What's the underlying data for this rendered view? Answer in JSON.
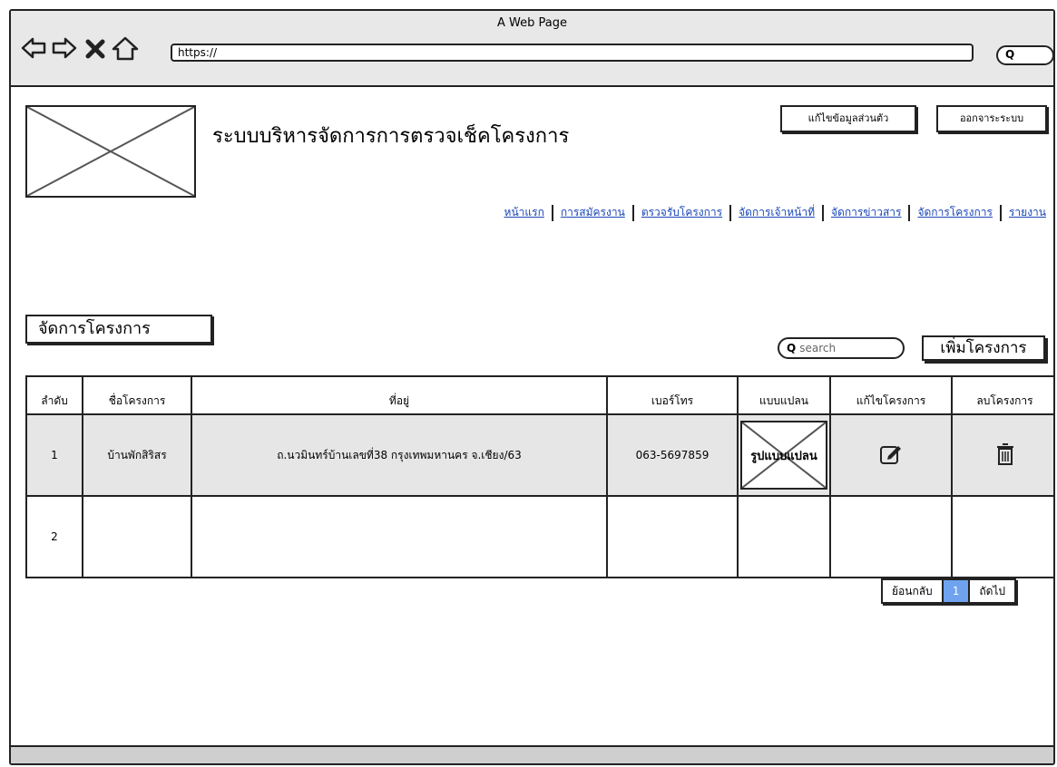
{
  "browser": {
    "window_title": "A Web Page",
    "url": "https://",
    "search_icon_label": "Q"
  },
  "header": {
    "app_title": "ระบบบริหารจัดการการตรวจเช็คโครงการ",
    "edit_profile_label": "แก้ไขข้อมูลส่วนตัว",
    "logout_label": "ออกจาระระบบ"
  },
  "menu": {
    "items": [
      {
        "label": "หน้าแรก"
      },
      {
        "label": "การสมัครงาน"
      },
      {
        "label": "ตรวจรับโครงการ"
      },
      {
        "label": "จัดการเจ้าหน้าที่"
      },
      {
        "label": "จัดการข่าวสาร"
      },
      {
        "label": "จัดการโครงการ"
      },
      {
        "label": "รายงาน"
      }
    ]
  },
  "content": {
    "section_title": "จัดการโครงการ",
    "search_placeholder": "search",
    "add_button_label": "เพิ่มโครงการ"
  },
  "table": {
    "headers": [
      "ลำดับ",
      "ชื่อโครงการ",
      "ที่อยู่",
      "เบอร์โทร",
      "แบบแปลน",
      "แก้ไขโครงการ",
      "ลบโครงการ"
    ],
    "rows": [
      {
        "no": "1",
        "name": "บ้านพักสิริสร",
        "address": "ถ.นวมินทร์บ้านเลขที่38 กรุงเทพมหานคร จ.เชียง/63",
        "phone": "063-5697859",
        "plan_label": "รูปแบบแปลน"
      },
      {
        "no": "2",
        "name": "",
        "address": "",
        "phone": "",
        "plan_label": ""
      }
    ]
  },
  "pagination": {
    "prev_label": "ย้อนกลับ",
    "current_page": "1",
    "next_label": "ถัดไป"
  }
}
